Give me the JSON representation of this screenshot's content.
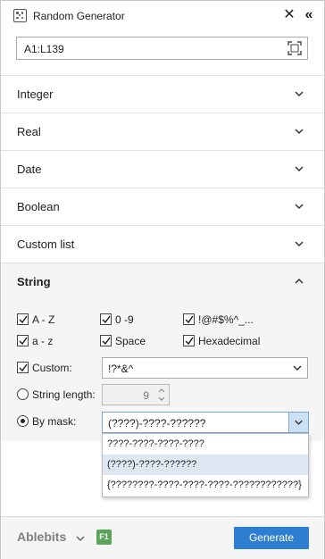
{
  "title": "Random Generator",
  "range": {
    "value": "A1:L139"
  },
  "sections": [
    {
      "label": "Integer"
    },
    {
      "label": "Real"
    },
    {
      "label": "Date"
    },
    {
      "label": "Boolean"
    },
    {
      "label": "Custom list"
    },
    {
      "label": "String"
    }
  ],
  "string": {
    "checkboxes": [
      {
        "label": "A - Z",
        "checked": true
      },
      {
        "label": "0 -9",
        "checked": true
      },
      {
        "label": "!@#$%^_...",
        "checked": true
      },
      {
        "label": "a - z",
        "checked": true
      },
      {
        "label": "Space",
        "checked": true
      },
      {
        "label": "Hexadecimal",
        "checked": true
      }
    ],
    "custom": {
      "label": "Custom:",
      "checked": true,
      "value": "!?*&^"
    },
    "length": {
      "label": "String length:",
      "value": "9"
    },
    "mask": {
      "label": "By mask:",
      "value": "(????)-????-??????"
    },
    "mask_options": [
      "????-????-????-????",
      "(????)-????-??????",
      "{????????-????-????-????-????????????}"
    ]
  },
  "footer": {
    "brand": "Ablebits",
    "help": "F1",
    "generate_label": "Generate"
  },
  "colors": {
    "accent": "#2e7fd1",
    "help": "#5aa55a",
    "selected_option": "#dde8f3"
  }
}
